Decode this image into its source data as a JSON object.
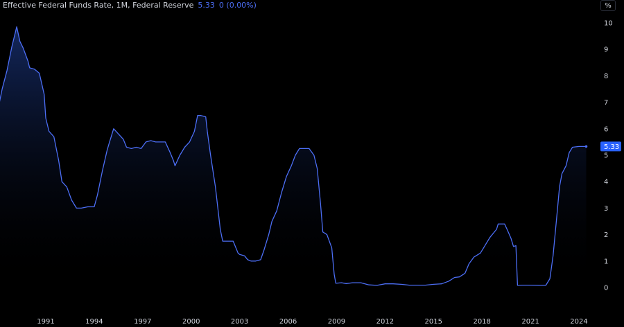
{
  "legend": {
    "title": "Effective Federal Funds Rate, 1M, Federal Reserve",
    "value": "5.33",
    "change": "0 (0.00%)"
  },
  "unit_button": "%",
  "last_value_label": "5.33",
  "colors": {
    "background": "#000000",
    "line": "#4c6ef5",
    "fill_top": "#152a63",
    "price_label": "#2962ff",
    "text": "#d1d4dc"
  },
  "chart_data": {
    "type": "area",
    "series": [
      {
        "x": [
          1988.0,
          1988.3,
          1988.6,
          1988.9,
          1989.2,
          1989.4,
          1989.6,
          1989.9,
          1990.0,
          1990.3,
          1990.6,
          1990.9,
          1991.0,
          1991.2,
          1991.5,
          1991.8,
          1992.0,
          1992.3,
          1992.6,
          1992.9,
          1993.2,
          1993.6,
          1994.0,
          1994.2,
          1994.5,
          1994.8,
          1994.95,
          1995.2,
          1995.5,
          1995.8,
          1996.0,
          1996.3,
          1996.6,
          1996.9,
          1997.2,
          1997.5,
          1997.8,
          1998.0,
          1998.4,
          1998.7,
          1998.9,
          1999.0,
          1999.3,
          1999.6,
          1999.9,
          2000.2,
          2000.4,
          2000.6,
          2000.9,
          2001.0,
          2001.2,
          2001.5,
          2001.8,
          2001.95,
          2002.2,
          2002.6,
          2002.9,
          2003.0,
          2003.3,
          2003.5,
          2003.7,
          2004.0,
          2004.3,
          2004.5,
          2004.8,
          2005.0,
          2005.3,
          2005.6,
          2005.9,
          2006.2,
          2006.45,
          2006.7,
          2007.0,
          2007.3,
          2007.6,
          2007.8,
          2008.0,
          2008.15,
          2008.4,
          2008.7,
          2008.85,
          2008.95,
          2009.3,
          2009.6,
          2010.0,
          2010.5,
          2011.0,
          2011.5,
          2012.0,
          2012.5,
          2013.0,
          2013.5,
          2014.0,
          2014.5,
          2015.0,
          2015.5,
          2015.95,
          2016.3,
          2016.6,
          2016.95,
          2017.2,
          2017.5,
          2017.9,
          2018.2,
          2018.5,
          2018.9,
          2019.0,
          2019.4,
          2019.6,
          2019.8,
          2019.95,
          2020.1,
          2020.2,
          2020.5,
          2021.0,
          2021.5,
          2021.95,
          2022.2,
          2022.4,
          2022.6,
          2022.8,
          2022.95,
          2023.2,
          2023.4,
          2023.6,
          2024.0,
          2024.3,
          2024.45
        ],
        "y": [
          6.6,
          7.5,
          8.2,
          9.1,
          9.85,
          9.3,
          9.05,
          8.55,
          8.3,
          8.25,
          8.1,
          7.3,
          6.4,
          5.9,
          5.7,
          4.8,
          4.0,
          3.8,
          3.3,
          3.0,
          3.0,
          3.05,
          3.05,
          3.5,
          4.4,
          5.2,
          5.5,
          6.0,
          5.8,
          5.6,
          5.3,
          5.25,
          5.3,
          5.25,
          5.5,
          5.55,
          5.5,
          5.5,
          5.5,
          5.1,
          4.8,
          4.6,
          5.0,
          5.3,
          5.5,
          5.9,
          6.5,
          6.5,
          6.45,
          5.9,
          5.0,
          3.8,
          2.2,
          1.75,
          1.75,
          1.75,
          1.3,
          1.25,
          1.2,
          1.05,
          1.0,
          1.0,
          1.05,
          1.4,
          2.0,
          2.5,
          2.9,
          3.6,
          4.2,
          4.6,
          5.0,
          5.25,
          5.25,
          5.25,
          5.0,
          4.5,
          3.2,
          2.1,
          2.0,
          1.5,
          0.5,
          0.16,
          0.18,
          0.15,
          0.18,
          0.18,
          0.1,
          0.08,
          0.14,
          0.14,
          0.12,
          0.09,
          0.09,
          0.09,
          0.12,
          0.14,
          0.24,
          0.38,
          0.4,
          0.54,
          0.9,
          1.15,
          1.3,
          1.6,
          1.9,
          2.2,
          2.4,
          2.4,
          2.13,
          1.85,
          1.55,
          1.58,
          0.08,
          0.09,
          0.09,
          0.08,
          0.08,
          0.33,
          1.2,
          2.5,
          3.8,
          4.3,
          4.6,
          5.1,
          5.3,
          5.33,
          5.33,
          5.33
        ]
      }
    ],
    "x_ticks": [
      "1991",
      "1994",
      "1997",
      "2000",
      "2003",
      "2006",
      "2009",
      "2012",
      "2015",
      "2018",
      "2021",
      "2024"
    ],
    "y_ticks": [
      "0",
      "1",
      "2",
      "3",
      "4",
      "5",
      "6",
      "7",
      "8",
      "9",
      "10"
    ],
    "xlim": [
      1988.0,
      2024.45
    ],
    "ylim": [
      0,
      10
    ],
    "grid": false,
    "legend_position": "top-left"
  }
}
